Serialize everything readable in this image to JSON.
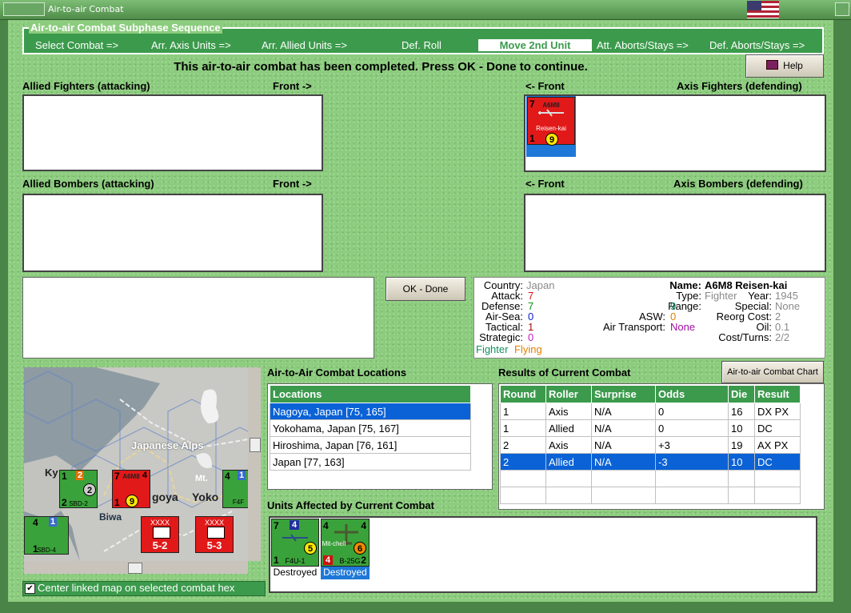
{
  "window": {
    "title": "Air-to-air Combat"
  },
  "subphase": {
    "title": "Air-to-air Combat Subphase Sequence",
    "steps": [
      "Select Combat =>",
      "Arr. Axis Units =>",
      "Arr. Allied Units =>",
      "Def. Roll",
      "Move 2nd Unit",
      "Att. Aborts/Stays =>",
      "Def. Aborts/Stays =>"
    ],
    "active_step": "Move 2nd Unit"
  },
  "message": "This air-to-air combat has been completed.  Press OK - Done to continue.",
  "help_label": "Help",
  "sections": {
    "allied_fighters": "Allied Fighters (attacking)",
    "allied_bombers": "Allied Bombers (attacking)",
    "axis_fighters": "Axis Fighters (defending)",
    "axis_bombers": "Axis Bombers (defending)",
    "front_right": "Front ->",
    "front_left": "<- Front"
  },
  "axis_fighter_unit": {
    "type": "A6M8",
    "name": "Reisen-kai",
    "top_left": "7",
    "bottom_left": "1",
    "circle": "9"
  },
  "ok_button": "OK - Done",
  "info": {
    "country_label": "Country:",
    "country": "Japan",
    "attack_label": "Attack:",
    "attack": "7",
    "defense_label": "Defense:",
    "defense": "7",
    "airsea_label": "Air-Sea:",
    "airsea": "0",
    "tactical_label": "Tactical:",
    "tactical": "1",
    "strategic_label": "Strategic:",
    "strategic": "0",
    "class": "Fighter",
    "status": "Flying",
    "name_label": "Name:",
    "name": "A6M8 Reisen-kai",
    "type_label": "Type:",
    "type": "Fighter",
    "range_label": "Range:",
    "range": "9",
    "asw_label": "ASW:",
    "asw": "0",
    "air_transport_label": "Air Transport:",
    "air_transport": "None",
    "year_label": "Year:",
    "year": "1945",
    "special_label": "Special:",
    "special": "None",
    "reorg_label": "Reorg Cost:",
    "reorg": "2",
    "oil_label": "Oil:",
    "oil": "0.1",
    "cost_label": "Cost/Turns:",
    "cost": "2/2",
    "colors": {
      "gray": "#8a8a8a",
      "red": "#d11",
      "green": "#109010",
      "blue": "#1020d0",
      "orange": "#e08000",
      "purple": "#a010a0"
    }
  },
  "locations": {
    "title": "Air-to-Air Combat Locations",
    "header": "Locations",
    "rows": [
      "Nagoya, Japan [75, 165]",
      "Yokohama, Japan [75, 167]",
      "Hiroshima, Japan [76, 161]",
      "Japan [77, 163]"
    ],
    "selected": 0
  },
  "results": {
    "title": "Results of Current Combat",
    "chart_button": "Air-to-air Combat Chart",
    "headers": [
      "Round",
      "Roller",
      "Surprise",
      "Odds",
      "Die",
      "Result"
    ],
    "rows": [
      [
        "1",
        "Axis",
        "N/A",
        "0",
        "16",
        "DX PX"
      ],
      [
        "1",
        "Allied",
        "N/A",
        "0",
        "10",
        "DC"
      ],
      [
        "2",
        "Axis",
        "N/A",
        "+3",
        "19",
        "AX PX"
      ],
      [
        "2",
        "Allied",
        "N/A",
        "-3",
        "10",
        "DC"
      ]
    ],
    "selected": 3
  },
  "affected": {
    "title": "Units Affected by Current Combat",
    "units": [
      {
        "name": "F4U-1",
        "top_left": "7",
        "badge": "4",
        "circle": "5",
        "bottom_left": "1",
        "status": "Destroyed"
      },
      {
        "name": "B-25G",
        "top_left": "4",
        "top_right": "4",
        "badge": "4",
        "circle": "6",
        "bottom_right": "2",
        "nick": "Mit-chell",
        "status": "Destroyed"
      }
    ]
  },
  "map": {
    "labels": [
      "Japanese Alps",
      "Mt.",
      "Ky",
      "goya",
      "Yoko",
      "Biwa"
    ],
    "units": [
      {
        "name": "SBD-2",
        "tl": "1",
        "tr": "2",
        "bl": "2",
        "circle": "2"
      },
      {
        "name": "A6M8",
        "tl": "7",
        "tr": "4",
        "bl": "1",
        "circle": "9"
      },
      {
        "name": "F4F",
        "tl": "4",
        "tr": "1"
      },
      {
        "name": "SBD-4",
        "tl": "4",
        "tr": "1",
        "bl": "1"
      },
      {
        "name": "5-2",
        "corps": "XXXX"
      },
      {
        "name": "5-3",
        "corps": "XXXX"
      }
    ]
  },
  "center_checkbox": {
    "label": "Center linked map on selected combat hex",
    "checked": true
  }
}
